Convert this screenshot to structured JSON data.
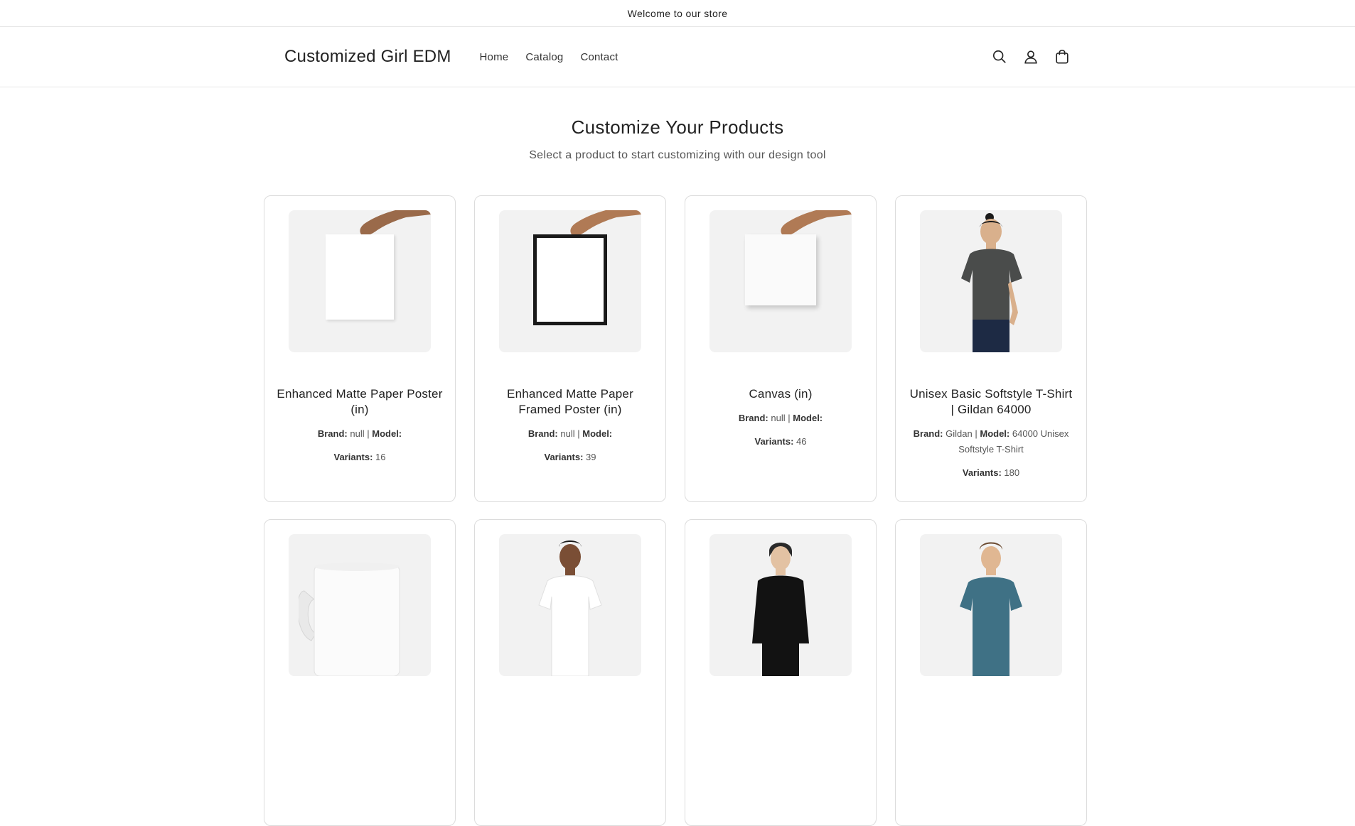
{
  "announcement": "Welcome to our store",
  "header": {
    "logo": "Customized Girl EDM",
    "nav": [
      {
        "label": "Home"
      },
      {
        "label": "Catalog"
      },
      {
        "label": "Contact"
      }
    ],
    "icons": [
      "search-icon",
      "account-icon",
      "cart-icon"
    ]
  },
  "hero": {
    "title": "Customize Your Products",
    "subtitle": "Select a product to start customizing with our design tool"
  },
  "labels": {
    "brand": "Brand:",
    "model": "Model:",
    "variants": "Variants:",
    "separator": "|"
  },
  "products": [
    {
      "title": "Enhanced Matte Paper Poster (in)",
      "brand": "null",
      "model": "",
      "variants": "16",
      "image": "poster-in-hand"
    },
    {
      "title": "Enhanced Matte Paper Framed Poster (in)",
      "brand": "null",
      "model": "",
      "variants": "39",
      "image": "framed-poster-in-hand"
    },
    {
      "title": "Canvas (in)",
      "brand": "null",
      "model": "",
      "variants": "46",
      "image": "canvas-in-hand"
    },
    {
      "title": "Unisex Basic Softstyle T-Shirt | Gildan 64000",
      "brand": "Gildan",
      "model": "64000 Unisex Softstyle T-Shirt",
      "variants": "180",
      "image": "man-dark-gray-tshirt"
    },
    {
      "image": "white-mug"
    },
    {
      "image": "man-white-tshirt"
    },
    {
      "image": "man-black-longsleeve"
    },
    {
      "image": "man-teal-tshirt"
    }
  ],
  "colors": {
    "border": "#dcdcdc",
    "media_bg": "#f2f2f2",
    "text": "#222222"
  }
}
